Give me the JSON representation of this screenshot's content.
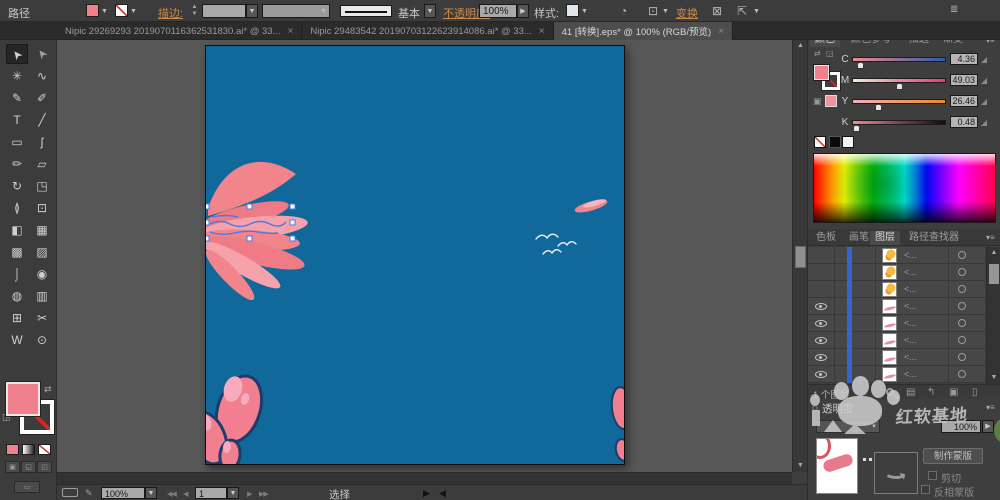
{
  "control_bar": {
    "panel_label": "路径",
    "stroke_label": "描边:",
    "brush_preset": "基本",
    "opacity_label": "不透明度:",
    "opacity_value": "100%",
    "style_label": "样式:",
    "transform_label": "变换"
  },
  "document_tabs": [
    {
      "title": "Nipic 29269293 2019070116362531830.ai* @ 33...",
      "close": "×"
    },
    {
      "title": "Nipic 29483542 20190703122623914086.ai* @ 33...",
      "close": "×"
    },
    {
      "title": "41 [转换].eps* @ 100% (RGB/预览)",
      "close": "×"
    }
  ],
  "color_panel": {
    "tabs": [
      "颜色",
      "颜色参考",
      "描边",
      "渐变"
    ],
    "sliders": [
      {
        "channel": "C",
        "value": "4.36"
      },
      {
        "channel": "M",
        "value": "49.03"
      },
      {
        "channel": "Y",
        "value": "26.46"
      },
      {
        "channel": "K",
        "value": "0.48"
      }
    ]
  },
  "panel_dock": {
    "tabs": [
      "色板",
      "画笔",
      "图层",
      "路径查找器"
    ],
    "layers_footer": "1 个图层",
    "layer_rows": [
      {
        "name": "<..."
      },
      {
        "name": "<..."
      },
      {
        "name": "<..."
      },
      {
        "name": "<..."
      },
      {
        "name": "<..."
      },
      {
        "name": "<..."
      },
      {
        "name": "<..."
      },
      {
        "name": "<..."
      }
    ]
  },
  "transparency": {
    "title": "透明度",
    "opacity_value": "100%",
    "make_mask": "制作蒙版",
    "clip": "剪切",
    "invert_mask": "反相蒙版"
  },
  "status_bar": {
    "zoom": "100%",
    "artboard": "1",
    "mode": "选择"
  },
  "watermark": {
    "text": "红软基地"
  },
  "colors": {
    "fill_pink": "#F0808C",
    "artboard_blue": "#10689B",
    "accent_orange": "#CE8B45",
    "selection_blue": "#3B6FD8"
  }
}
